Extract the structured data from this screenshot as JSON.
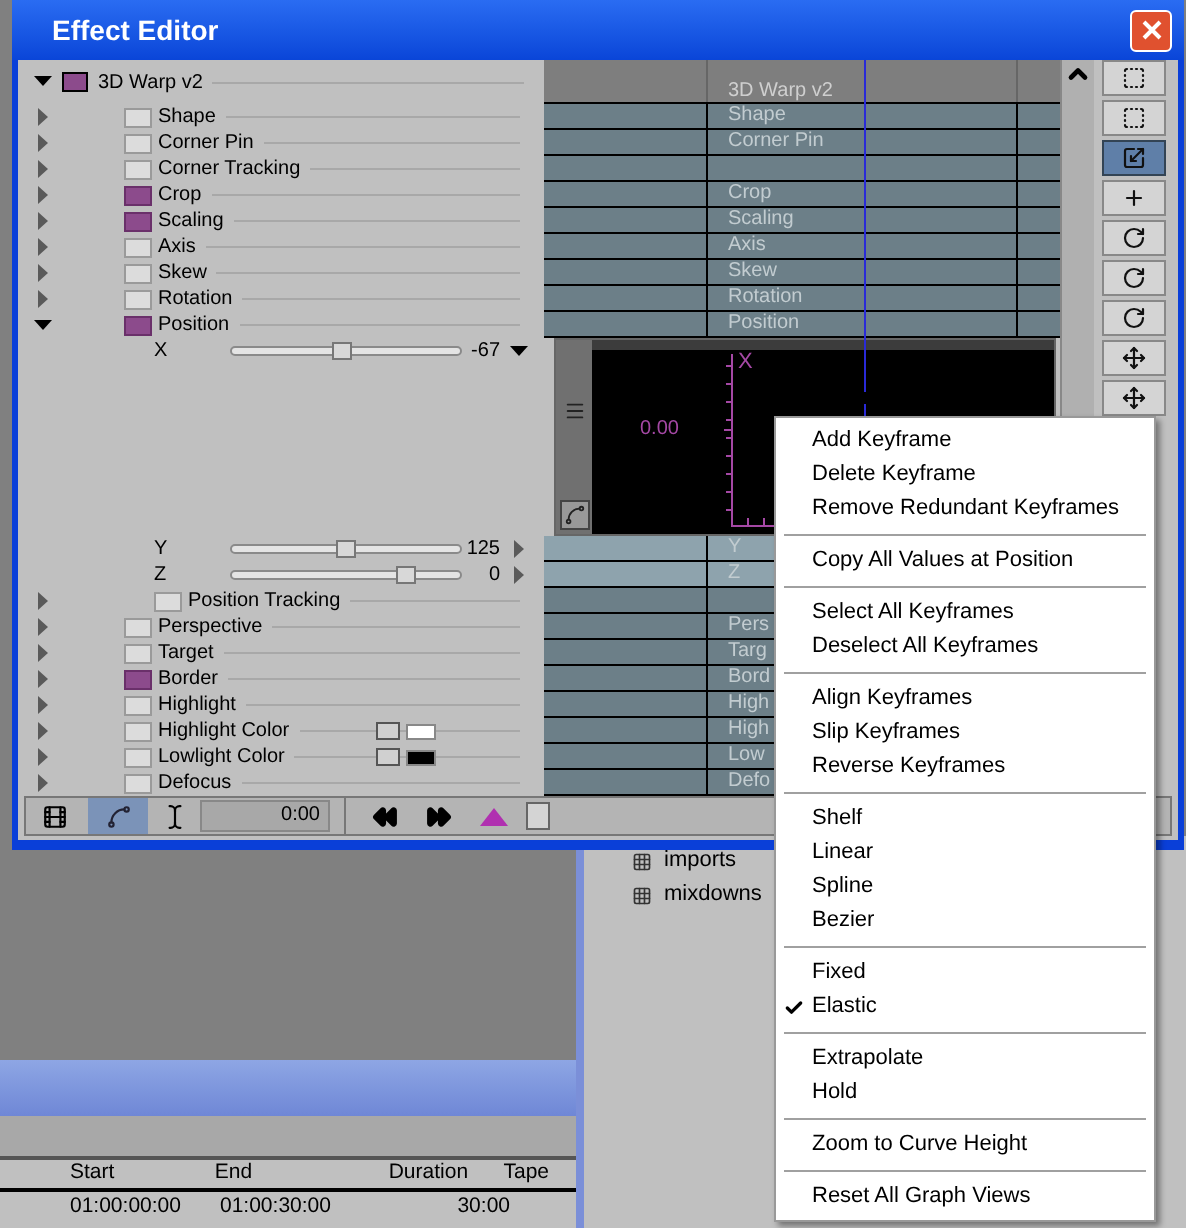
{
  "window": {
    "title": "Effect Editor"
  },
  "effect": {
    "label": "3D Warp v2",
    "expanded": true,
    "track": "3D Warp v2",
    "children": [
      {
        "kind": "param",
        "label": "Shape",
        "enabled": false,
        "expanded": false,
        "track": "Shape"
      },
      {
        "kind": "param",
        "label": "Corner Pin",
        "enabled": false,
        "expanded": false,
        "track": "Corner Pin"
      },
      {
        "kind": "param",
        "label": "Corner Tracking",
        "enabled": false,
        "expanded": false
      },
      {
        "kind": "param",
        "label": "Crop",
        "enabled": true,
        "expanded": false,
        "track": "Crop"
      },
      {
        "kind": "param",
        "label": "Scaling",
        "enabled": true,
        "expanded": false,
        "track": "Scaling"
      },
      {
        "kind": "param",
        "label": "Axis",
        "enabled": false,
        "expanded": false,
        "track": "Axis"
      },
      {
        "kind": "param",
        "label": "Skew",
        "enabled": false,
        "expanded": false,
        "track": "Skew"
      },
      {
        "kind": "param",
        "label": "Rotation",
        "enabled": false,
        "expanded": false,
        "track": "Rotation"
      },
      {
        "kind": "param",
        "label": "Position",
        "enabled": true,
        "expanded": true,
        "track": "Position",
        "children": [
          {
            "kind": "slider",
            "label": "X",
            "level": 0.48,
            "value": "-67",
            "expanded": true,
            "graph": {
              "axis_label": "X",
              "value_label": "0.00"
            }
          },
          {
            "kind": "slider",
            "label": "Y",
            "level": 0.5,
            "value": "125",
            "expanded": false,
            "track": "Y"
          },
          {
            "kind": "slider",
            "label": "Z",
            "level": 0.76,
            "value": "0",
            "expanded": false,
            "track": "Z"
          },
          {
            "kind": "param",
            "label": "Position Tracking",
            "enabled": false,
            "expanded": false
          }
        ]
      },
      {
        "kind": "param",
        "label": "Perspective",
        "enabled": false,
        "expanded": false,
        "track": "Pers"
      },
      {
        "kind": "param",
        "label": "Target",
        "enabled": false,
        "expanded": false,
        "track": "Targ"
      },
      {
        "kind": "param",
        "label": "Border",
        "enabled": true,
        "expanded": false,
        "track": "Bord"
      },
      {
        "kind": "param",
        "label": "Highlight",
        "enabled": false,
        "expanded": false,
        "track": "High"
      },
      {
        "kind": "color",
        "label": "Highlight Color",
        "enabled": false,
        "expanded": false,
        "color": "#ffffff",
        "track": "High"
      },
      {
        "kind": "color",
        "label": "Lowlight Color",
        "enabled": false,
        "expanded": false,
        "color": "#000000",
        "track": "Low"
      },
      {
        "kind": "param",
        "label": "Defocus",
        "enabled": false,
        "expanded": false,
        "track": "Defo"
      }
    ]
  },
  "tools": [
    {
      "kind": "select",
      "selected": false
    },
    {
      "kind": "box",
      "selected": false
    },
    {
      "kind": "scale",
      "selected": true
    },
    {
      "kind": "center",
      "selected": false
    },
    {
      "kind": "rotate",
      "selected": false
    },
    {
      "kind": "rotate",
      "selected": false
    },
    {
      "kind": "rotate",
      "selected": false
    },
    {
      "kind": "move",
      "selected": false
    },
    {
      "kind": "move",
      "selected": false
    }
  ],
  "toolbar": {
    "graph_mode_selected": true,
    "time": "0:00"
  },
  "context_menu": {
    "groups": [
      [
        {
          "label": "Add Keyframe",
          "checked": false
        },
        {
          "label": "Delete Keyframe",
          "checked": false
        },
        {
          "label": "Remove Redundant Keyframes",
          "checked": false
        }
      ],
      [
        {
          "label": "Copy All Values at Position",
          "checked": false
        }
      ],
      [
        {
          "label": "Select All Keyframes",
          "checked": false
        },
        {
          "label": "Deselect All Keyframes",
          "checked": false
        }
      ],
      [
        {
          "label": "Align Keyframes",
          "checked": false
        },
        {
          "label": "Slip Keyframes",
          "checked": false
        },
        {
          "label": "Reverse Keyframes",
          "checked": false
        }
      ],
      [
        {
          "label": "Shelf",
          "checked": false
        },
        {
          "label": "Linear",
          "checked": false
        },
        {
          "label": "Spline",
          "checked": false
        },
        {
          "label": "Bezier",
          "checked": false
        }
      ],
      [
        {
          "label": "Fixed",
          "checked": false
        },
        {
          "label": "Elastic",
          "checked": true
        }
      ],
      [
        {
          "label": "Extrapolate",
          "checked": false
        },
        {
          "label": "Hold",
          "checked": false
        }
      ],
      [
        {
          "label": "Zoom to Curve Height",
          "checked": false
        }
      ],
      [
        {
          "label": "Reset All Graph Views",
          "checked": false
        }
      ]
    ]
  },
  "bin": {
    "items": [
      "imports",
      "mixdowns"
    ]
  },
  "sequence_table": {
    "columns": [
      "Start",
      "End",
      "Duration",
      "Tape"
    ],
    "rows": [
      [
        "01:00:00:00",
        "01:00:30:00",
        "30:00"
      ]
    ]
  }
}
